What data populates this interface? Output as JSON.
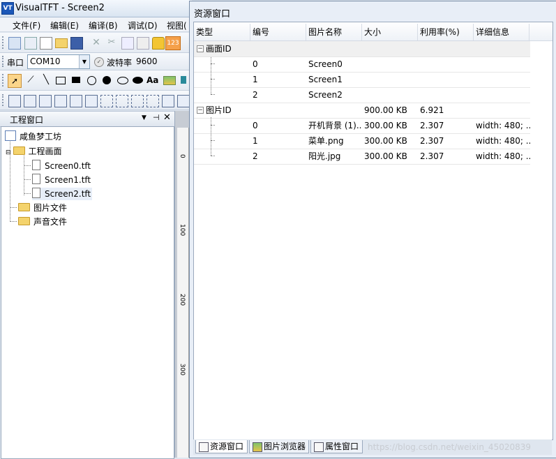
{
  "app": {
    "logo_text": "VT",
    "title": "VisualTFT - Screen2"
  },
  "menu": [
    "文件(F)",
    "编辑(E)",
    "编译(B)",
    "调试(D)",
    "视图("
  ],
  "toolbar": {
    "counter_badge": "123",
    "text_tool": "Aa"
  },
  "serial": {
    "label": "串口",
    "port": "COM10",
    "baud_label": "波特率",
    "baud_value": "9600"
  },
  "project_panel": {
    "title": "工程窗口",
    "tree": {
      "root": "咸鱼梦工坊",
      "folder_screens": "工程画面",
      "files": [
        "Screen0.tft",
        "Screen1.tft",
        "Screen2.tft"
      ],
      "folder_images": "图片文件",
      "folder_sounds": "声音文件"
    }
  },
  "ruler": {
    "ticks": [
      "0",
      "100",
      "200",
      "300"
    ]
  },
  "resource_window": {
    "title": "资源窗口",
    "columns": [
      "类型",
      "编号",
      "图片名称",
      "大小",
      "利用率(%)",
      "详细信息"
    ],
    "screen_group": {
      "label": "画面ID",
      "rows": [
        {
          "id": "0",
          "name": "Screen0"
        },
        {
          "id": "1",
          "name": "Screen1"
        },
        {
          "id": "2",
          "name": "Screen2"
        }
      ]
    },
    "image_group": {
      "label": "图片ID",
      "size": "900.00 KB",
      "usage": "6.921",
      "rows": [
        {
          "id": "0",
          "name": "开机背景 (1)...",
          "size": "300.00 KB",
          "usage": "2.307",
          "detail": "width: 480; ..."
        },
        {
          "id": "1",
          "name": "菜单.png",
          "size": "300.00 KB",
          "usage": "2.307",
          "detail": "width: 480; ..."
        },
        {
          "id": "2",
          "name": "阳光.jpg",
          "size": "300.00 KB",
          "usage": "2.307",
          "detail": "width: 480; ..."
        }
      ]
    },
    "tabs": [
      "资源窗口",
      "图片浏览器",
      "属性窗口"
    ],
    "watermark": "https://blog.csdn.net/weixin_45020839"
  }
}
